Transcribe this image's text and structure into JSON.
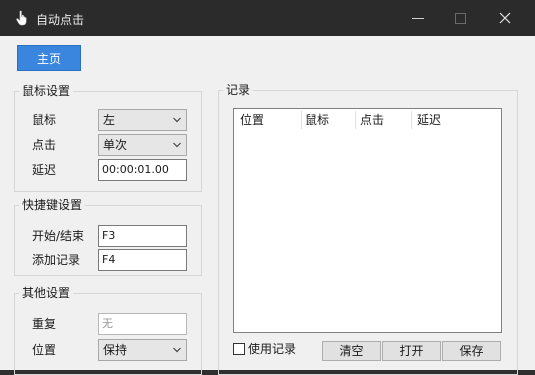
{
  "window": {
    "title": "自动点击"
  },
  "home_button": "主页",
  "mouse_settings": {
    "title": "鼠标设置",
    "button_label": "鼠标",
    "button_value": "左",
    "click_label": "点击",
    "click_value": "单次",
    "delay_label": "延迟",
    "delay_value": "00:00:01.00"
  },
  "hotkey_settings": {
    "title": "快捷键设置",
    "start_stop_label": "开始/结束",
    "start_stop_value": "F3",
    "add_record_label": "添加记录",
    "add_record_value": "F4"
  },
  "other_settings": {
    "title": "其他设置",
    "repeat_label": "重复",
    "repeat_value": "无",
    "position_label": "位置",
    "position_value": "保持"
  },
  "records": {
    "title": "记录",
    "columns": [
      "位置",
      "鼠标",
      "点击",
      "延迟"
    ],
    "use_records_label": "使用记录",
    "clear_label": "清空",
    "open_label": "打开",
    "save_label": "保存"
  },
  "colors": {
    "titlebar": "#2b2b2b",
    "accent": "#3a86de",
    "background": "#f0f0f0"
  },
  "icons": {
    "app": "hand-pointer-icon"
  }
}
